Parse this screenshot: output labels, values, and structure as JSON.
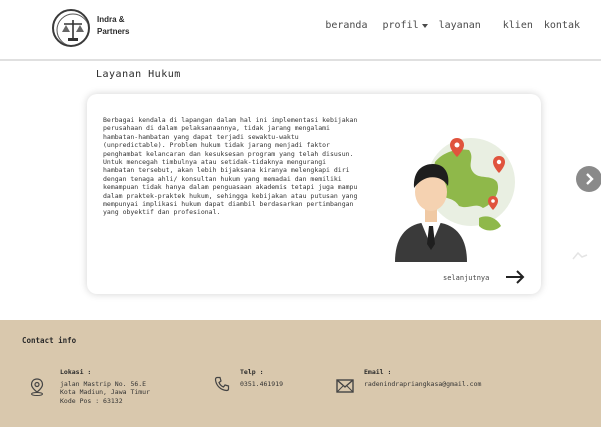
{
  "header": {
    "brand_line1": "Indra &",
    "brand_line2": "Partners",
    "nav": [
      "beranda",
      "profil",
      "layanan",
      "klien",
      "kontak"
    ]
  },
  "section": {
    "title": "Layanan Hukum"
  },
  "card": {
    "text": "Berbagai kendala di lapangan dalam hal ini implementasi kebijakan perusahaan di dalam pelaksanaannya, tidak jarang mengalami hambatan-hambatan yang dapat terjadi sewaktu-waktu (unpredictable). Problem hukum tidak jarang menjadi faktor penghambat kelancaran dan kesuksesan program yang telah disusun. Untuk mencegah timbulnya atau setidak-tidaknya mengurangi hambatan tersebut, akan lebih bijaksana kiranya melengkapi diri dengan tenaga ahli/ konsultan hukum yang memadai dan memiliki kemampuan tidak hanya dalam penguasaan akademis tetapi juga mampu dalam praktek-praktek hukum, sehingga kebijakan atau putusan yang mempunyai implikasi hukum dapat diambil berdasarkan pertimbangan yang obyektif dan profesional.",
    "more_label": "selanjutnya"
  },
  "footer": {
    "heading": "Contact info",
    "location": {
      "label": "Lokasi :",
      "lines": [
        "jalan Mastrip No. 56.E",
        "Kota Madiun, Jawa Timur",
        "Kode Pos : 63132"
      ]
    },
    "phone": {
      "label": "Telp :",
      "value": "0351.461919"
    },
    "email": {
      "label": "Email :",
      "value": "radenindrapriangkasa@gmail.com"
    }
  },
  "colors": {
    "footer_bg": "#d9c8ad",
    "accent_pin": "#e0533d",
    "globe_green": "#8fb84a"
  },
  "icons": [
    "logo-emblem",
    "dropdown-caret",
    "arrow-right-icon",
    "chevron-right-icon",
    "location-icon",
    "phone-icon",
    "mail-icon"
  ]
}
